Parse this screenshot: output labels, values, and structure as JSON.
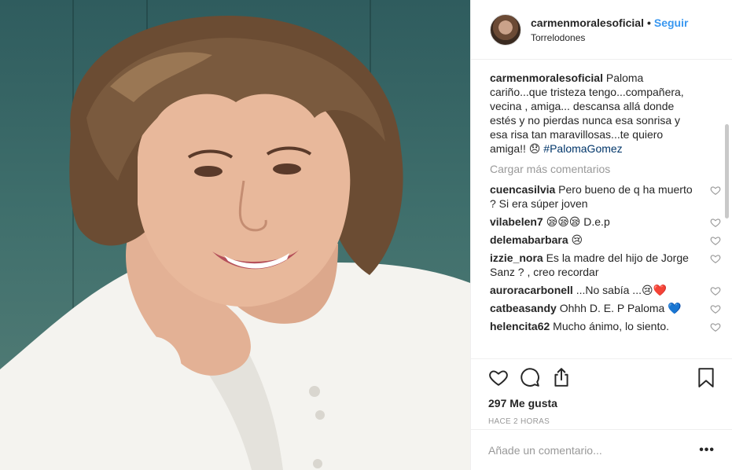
{
  "post": {
    "username": "carmenmoralesoficial",
    "separator": "•",
    "follow_label": "Seguir",
    "location": "Torrelodones"
  },
  "caption": {
    "username": "carmenmoralesoficial",
    "text": "Paloma cariño...que tristeza tengo...compañera, vecina , amiga... descansa allá donde estés y no pierdas nunca esa sonrisa y esa risa tan maravillosas...te quiero amiga!! 😞 ",
    "hashtag": "#PalomaGomez"
  },
  "load_more_label": "Cargar más comentarios",
  "comments": [
    {
      "username": "cuencasilvia",
      "text": "Pero bueno de q ha muerto ? Si era súper joven"
    },
    {
      "username": "vilabelen7",
      "text": "😪😪😪 D.e.p"
    },
    {
      "username": "delemabarbara",
      "text": "😢"
    },
    {
      "username": "izzie_nora",
      "text": "Es la madre del hijo de Jorge Sanz ? , creo recordar"
    },
    {
      "username": "auroracarbonell",
      "text": "...No sabía ...😢❤️"
    },
    {
      "username": "catbeasandy",
      "text": "Ohhh D. E. P Paloma 💙"
    },
    {
      "username": "helencita62",
      "text": "Mucho ánimo, lo siento."
    }
  ],
  "likes_label": "297 Me gusta",
  "timestamp": "HACE 2 HORAS",
  "add_comment_placeholder": "Añade un comentario...",
  "more_options": "•••",
  "icons": {
    "like": "heart-icon",
    "comment": "comment-icon",
    "share": "share-icon",
    "save": "bookmark-icon",
    "comment_like": "heart-icon"
  },
  "colors": {
    "accent": "#3897f0",
    "hashtag": "#003569",
    "muted": "#999999",
    "text": "#262626"
  }
}
